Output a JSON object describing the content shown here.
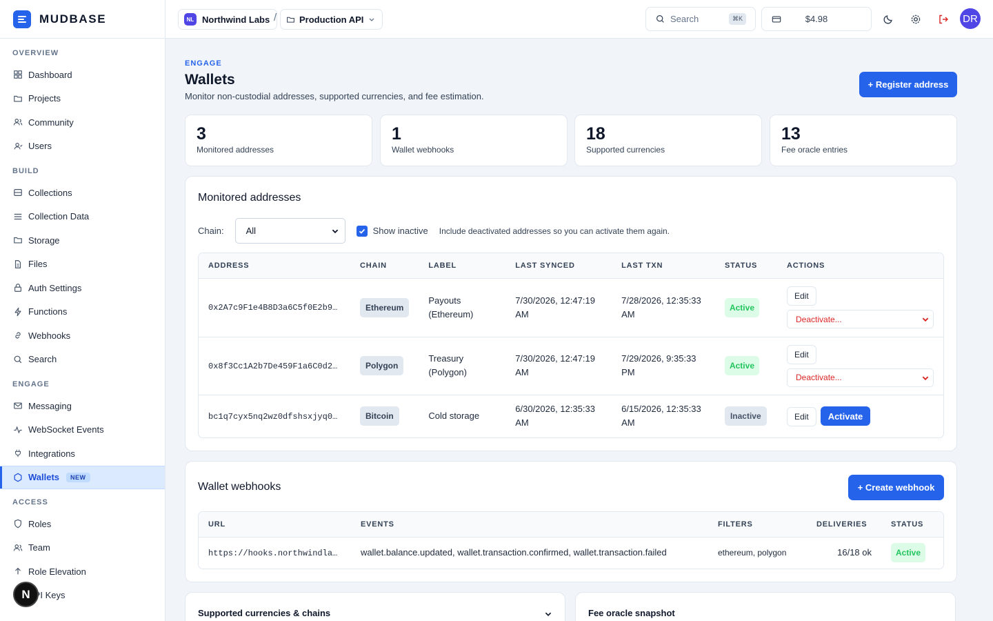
{
  "brand": {
    "name": "MUDBASE"
  },
  "sidebar": {
    "sections": [
      {
        "label": "OVERVIEW",
        "items": [
          {
            "label": "Dashboard",
            "icon": "grid-icon"
          },
          {
            "label": "Projects",
            "icon": "folder-icon"
          },
          {
            "label": "Community",
            "icon": "users-icon"
          },
          {
            "label": "Users",
            "icon": "user-icon"
          }
        ]
      },
      {
        "label": "BUILD",
        "items": [
          {
            "label": "Collections",
            "icon": "database-icon"
          },
          {
            "label": "Collection Data",
            "icon": "list-icon"
          },
          {
            "label": "Storage",
            "icon": "folder-icon"
          },
          {
            "label": "Files",
            "icon": "file-icon"
          },
          {
            "label": "Auth Settings",
            "icon": "lock-icon"
          },
          {
            "label": "Functions",
            "icon": "bolt-icon"
          },
          {
            "label": "Webhooks",
            "icon": "link-icon"
          },
          {
            "label": "Search",
            "icon": "search-icon"
          }
        ]
      },
      {
        "label": "ENGAGE",
        "items": [
          {
            "label": "Messaging",
            "icon": "mail-icon"
          },
          {
            "label": "WebSocket Events",
            "icon": "activity-icon"
          },
          {
            "label": "Integrations",
            "icon": "plug-icon"
          },
          {
            "label": "Wallets",
            "icon": "hexagon-icon",
            "badge": "NEW",
            "active": true
          }
        ]
      },
      {
        "label": "ACCESS",
        "items": [
          {
            "label": "Roles",
            "icon": "shield-icon"
          },
          {
            "label": "Team",
            "icon": "users-icon"
          },
          {
            "label": "Role Elevation",
            "icon": "arrow-up-icon"
          },
          {
            "label": "API Keys",
            "icon": "key-icon"
          }
        ]
      }
    ],
    "floating_badge": "N"
  },
  "topbar": {
    "org": {
      "initials": "NL",
      "name": "Northwind Labs"
    },
    "separator": "/",
    "project": {
      "name": "Production API"
    },
    "search": {
      "placeholder": "Search",
      "shortcut": "⌘K"
    },
    "balance": "$4.98",
    "avatar": "DR"
  },
  "page": {
    "eyebrow": "ENGAGE",
    "title": "Wallets",
    "subtitle": "Monitor non-custodial addresses, supported currencies, and fee estimation.",
    "register_button": "+ Register address"
  },
  "stats": [
    {
      "value": "3",
      "label": "Monitored addresses"
    },
    {
      "value": "1",
      "label": "Wallet webhooks"
    },
    {
      "value": "18",
      "label": "Supported currencies"
    },
    {
      "value": "13",
      "label": "Fee oracle entries"
    }
  ],
  "addresses": {
    "title": "Monitored addresses",
    "chain_label": "Chain:",
    "chain_value": "All",
    "show_inactive_label": "Show inactive",
    "show_inactive_hint": "Include deactivated addresses so you can activate them again.",
    "show_inactive_checked": true,
    "columns": [
      "ADDRESS",
      "CHAIN",
      "LABEL",
      "LAST SYNCED",
      "LAST TXN",
      "STATUS",
      "ACTIONS"
    ],
    "rows": [
      {
        "address": "0x2A7c9F1e4B8D3a6C5f0E2b9…",
        "chain": "Ethereum",
        "label": "Payouts (Ethereum)",
        "last_synced": "7/30/2026, 12:47:19 AM",
        "last_txn": "7/28/2026, 12:35:33 AM",
        "status": "Active",
        "edit": "Edit",
        "action": "Deactivate..."
      },
      {
        "address": "0x8f3Cc1A2b7De459F1a6C0d2…",
        "chain": "Polygon",
        "label": "Treasury (Polygon)",
        "last_synced": "7/30/2026, 12:47:19 AM",
        "last_txn": "7/29/2026, 9:35:33 PM",
        "status": "Active",
        "edit": "Edit",
        "action": "Deactivate..."
      },
      {
        "address": "bc1q7cyx5nq2wz0dfshsxjyq0…",
        "chain": "Bitcoin",
        "label": "Cold storage",
        "last_synced": "6/30/2026, 12:35:33 AM",
        "last_txn": "6/15/2026, 12:35:33 AM",
        "status": "Inactive",
        "edit": "Edit",
        "action": "Activate"
      }
    ]
  },
  "webhooks": {
    "title": "Wallet webhooks",
    "create_button": "+ Create webhook",
    "columns": [
      "URL",
      "EVENTS",
      "FILTERS",
      "DELIVERIES",
      "STATUS"
    ],
    "rows": [
      {
        "url": "https://hooks.northwindla…",
        "events": "wallet.balance.updated, wallet.transaction.confirmed, wallet.transaction.failed",
        "filters": "ethereum, polygon",
        "deliveries": "16/18 ok",
        "status": "Active"
      }
    ]
  },
  "bottom_cards": [
    {
      "title": "Supported currencies & chains"
    },
    {
      "title": "Fee oracle snapshot"
    }
  ],
  "colors": {
    "accent": "#2563eb",
    "danger": "#dc2626",
    "success": "#22c55e"
  }
}
